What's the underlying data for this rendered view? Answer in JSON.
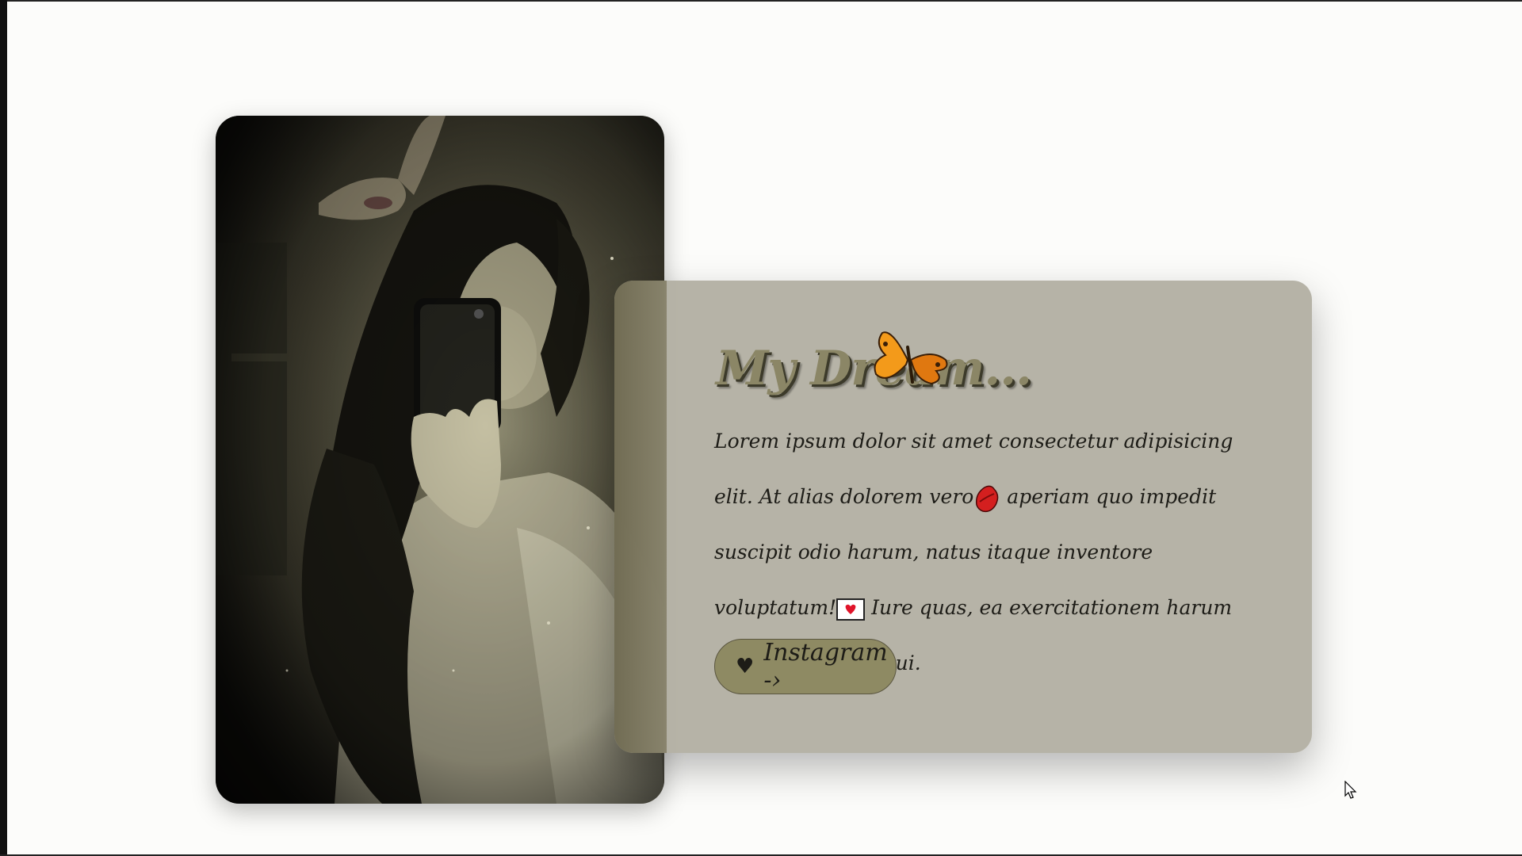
{
  "card": {
    "title": "My Dream...",
    "body_part1": "Lorem ipsum dolor sit amet consectetur adipisicing elit. At alias dolorem vero",
    "body_part2": " aperiam quo impedit suscipit odio harum, natus itaque inventore voluptatum!",
    "body_part3": " Iure quas, ea exercitationem harum molestias eaque qui.",
    "button_label": "Instagram -›",
    "button_icon": "♥"
  },
  "icons": {
    "butterfly": "butterfly-icon",
    "lips": "lips-icon",
    "love_letter": "love-letter-icon",
    "heart": "heart-icon",
    "cursor": "mouse-pointer-icon"
  },
  "colors": {
    "page_background": "#fcfcfa",
    "card_background": "#b0ada0",
    "button_background": "#8e8a63",
    "title_color": "#8b8666",
    "text_color": "#1d1c17"
  }
}
